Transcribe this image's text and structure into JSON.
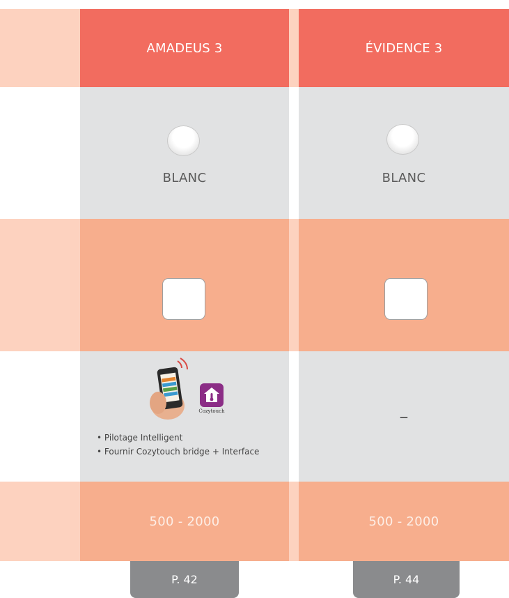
{
  "columns": [
    {
      "title": "AMADEUS 3",
      "color": "BLANC",
      "power_range": "500 - 2000",
      "page": "P. 42"
    },
    {
      "title": "ÉVIDENCE 3",
      "color": "BLANC",
      "power_range": "500 - 2000",
      "page": "P. 44"
    }
  ],
  "cozytouch": {
    "app_label": "Cozytouch",
    "bullets": [
      "• Pilotage Intelligent",
      "• Fournir Cozytouch bridge + Interface"
    ],
    "unavailable": "–"
  },
  "colors": {
    "header": "#f26c5f",
    "gray_row": "#e1e2e3",
    "salmon_row": "#f7ae8d",
    "pale_column": "#fdd2bf",
    "page_button": "#8a8b8d",
    "cozytouch_app": "#8b2d86"
  }
}
